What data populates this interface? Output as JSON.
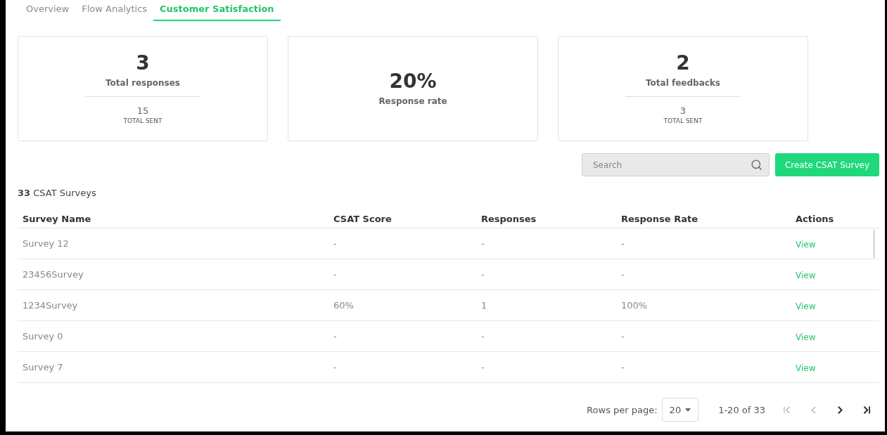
{
  "tabs": [
    {
      "label": "Overview",
      "selected": false
    },
    {
      "label": "Flow Analytics",
      "selected": false
    },
    {
      "label": "Customer Satisfaction",
      "selected": true
    }
  ],
  "stats": [
    {
      "kind": "split",
      "value": "3",
      "label": "Total responses",
      "sub_value": "15",
      "sub_label": "TOTAL SENT"
    },
    {
      "kind": "single",
      "value": "20%",
      "label": "Response rate"
    },
    {
      "kind": "split",
      "value": "2",
      "label": "Total feedbacks",
      "sub_value": "3",
      "sub_label": "TOTAL SENT"
    }
  ],
  "search": {
    "placeholder": "Search"
  },
  "create_button": "Create CSAT Survey",
  "survey_count": {
    "count": "33",
    "label": "CSAT Surveys"
  },
  "table": {
    "columns": [
      "Survey Name",
      "CSAT Score",
      "Responses",
      "Response Rate",
      "Actions"
    ],
    "rows": [
      [
        "Survey 12",
        "-",
        "-",
        "-",
        "View"
      ],
      [
        "23456Survey",
        "-",
        "-",
        "-",
        "View"
      ],
      [
        "1234Survey",
        "60%",
        "1",
        "100%",
        "View"
      ],
      [
        "Survey 0",
        "-",
        "-",
        "-",
        "View"
      ],
      [
        "Survey 7",
        "-",
        "-",
        "-",
        "View"
      ]
    ]
  },
  "pagination": {
    "rows_per_page_label": "Rows per page:",
    "rows_per_page": "20",
    "range": "1-20 of 33",
    "buttons": [
      {
        "kind": "first",
        "disabled": true
      },
      {
        "kind": "prev",
        "disabled": true
      },
      {
        "kind": "next",
        "disabled": false
      },
      {
        "kind": "last",
        "disabled": false
      }
    ]
  }
}
